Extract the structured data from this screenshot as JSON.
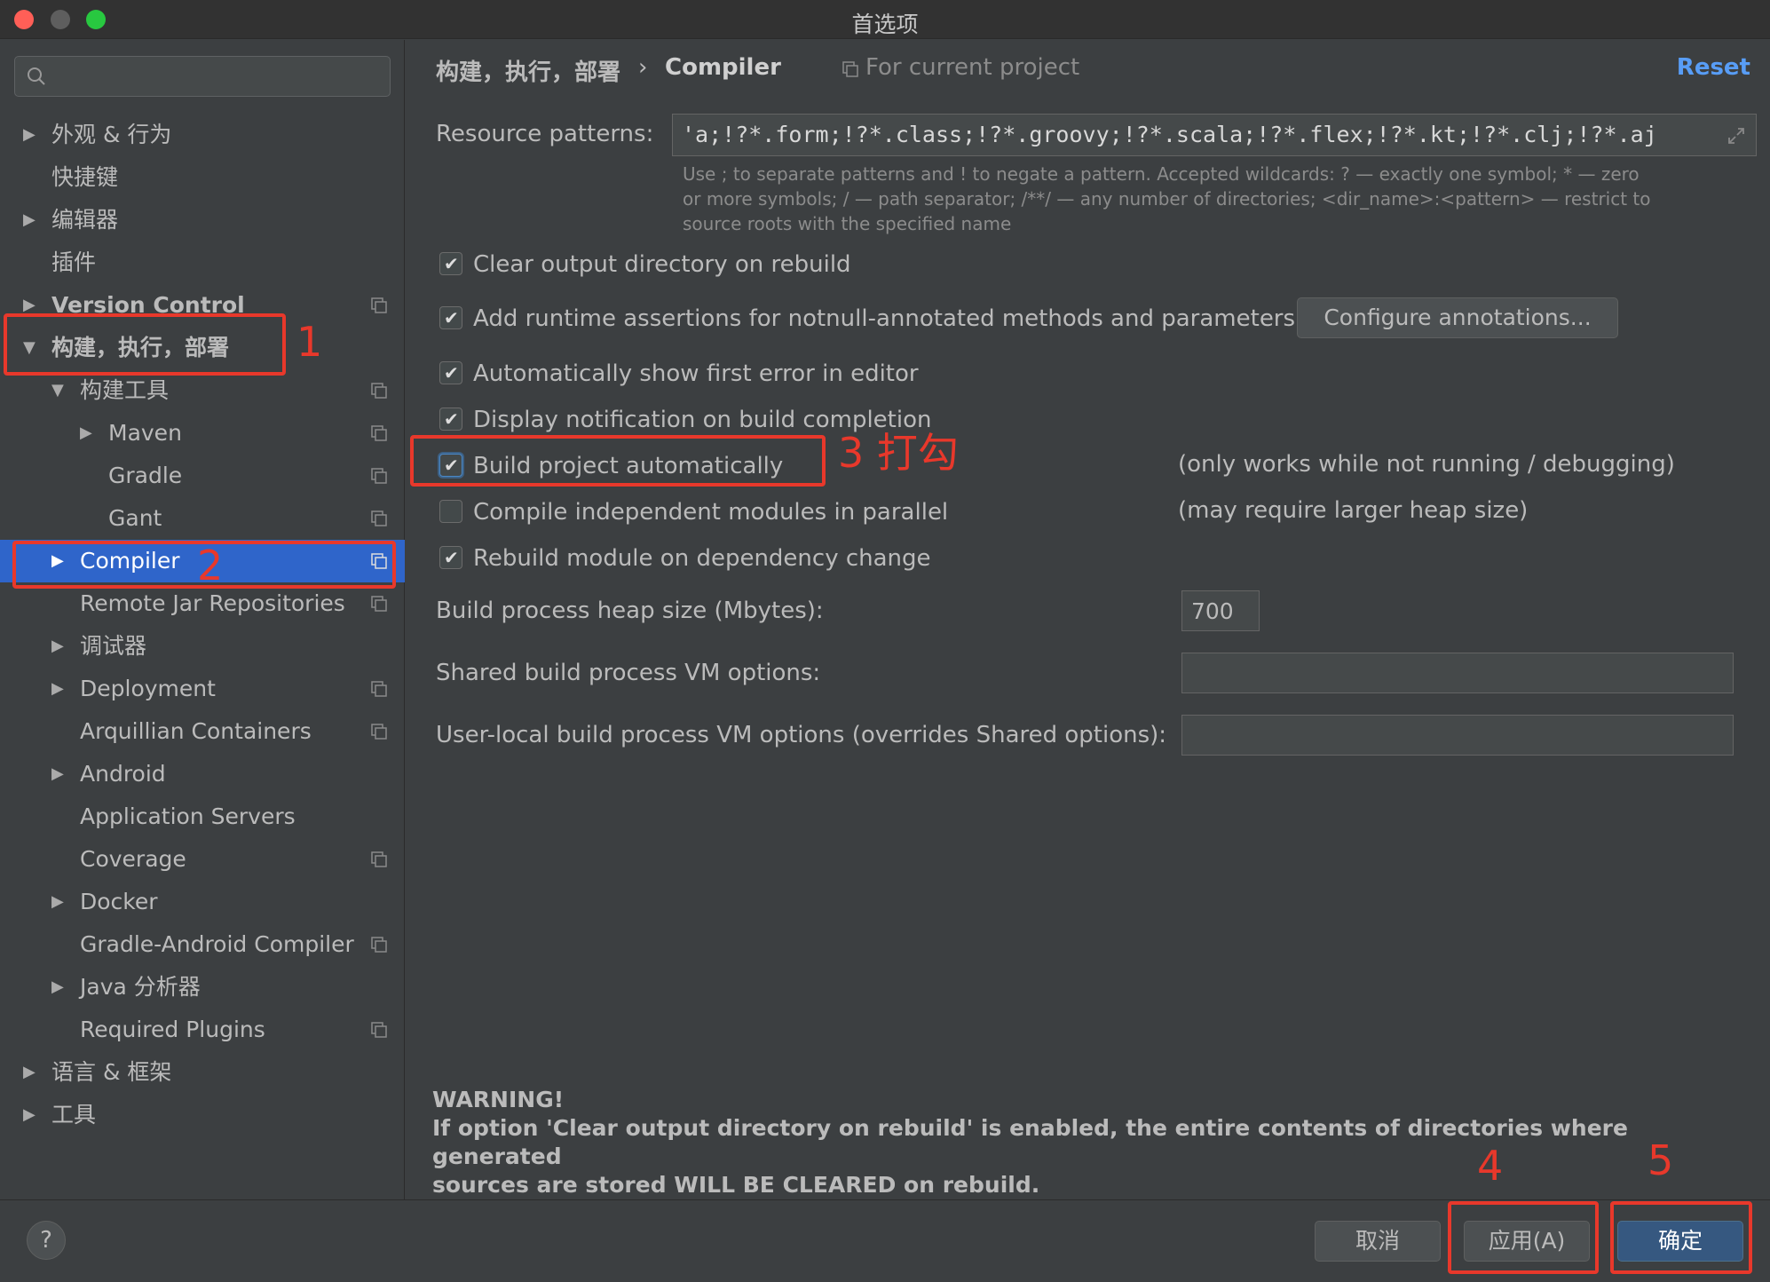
{
  "window": {
    "title": "首选项"
  },
  "search": {
    "placeholder": ""
  },
  "sidebar": {
    "items": [
      {
        "label": "外观 & 行为"
      },
      {
        "label": "快捷键"
      },
      {
        "label": "编辑器"
      },
      {
        "label": "插件"
      },
      {
        "label": "Version Control"
      },
      {
        "label": "构建，执行，部署"
      },
      {
        "label": "构建工具"
      },
      {
        "label": "Maven"
      },
      {
        "label": "Gradle"
      },
      {
        "label": "Gant"
      },
      {
        "label": "Compiler"
      },
      {
        "label": "Remote Jar Repositories"
      },
      {
        "label": "调试器"
      },
      {
        "label": "Deployment"
      },
      {
        "label": "Arquillian Containers"
      },
      {
        "label": "Android"
      },
      {
        "label": "Application Servers"
      },
      {
        "label": "Coverage"
      },
      {
        "label": "Docker"
      },
      {
        "label": "Gradle-Android Compiler"
      },
      {
        "label": "Java 分析器"
      },
      {
        "label": "Required Plugins"
      },
      {
        "label": "语言 & 框架"
      },
      {
        "label": "工具"
      }
    ],
    "selected": "Compiler"
  },
  "breadcrumb": {
    "parent": "构建，执行，部署",
    "separator": "›",
    "current": "Compiler",
    "scope_note": "For current project"
  },
  "header": {
    "reset_label": "Reset"
  },
  "settings": {
    "resource_patterns_label": "Resource patterns:",
    "resource_patterns_value": "'a;!?*.form;!?*.class;!?*.groovy;!?*.scala;!?*.flex;!?*.kt;!?*.clj;!?*.aj",
    "resource_hint_1": "Use ; to separate patterns and ! to negate a pattern. Accepted wildcards: ? — exactly one symbol; * — zero",
    "resource_hint_2": "or more symbols; / — path separator; /**/ — any number of directories; <dir_name>:<pattern> — restrict to",
    "resource_hint_3": "source roots with the specified name",
    "checkboxes": [
      {
        "label": "Clear output directory on rebuild",
        "checked": true
      },
      {
        "label": "Add runtime assertions for notnull-annotated methods and parameters",
        "checked": true
      },
      {
        "label": "Automatically show first error in editor",
        "checked": true
      },
      {
        "label": "Display notification on build completion",
        "checked": true
      },
      {
        "label": "Build project automatically",
        "checked": true
      },
      {
        "label": "Compile independent modules in parallel",
        "checked": false
      },
      {
        "label": "Rebuild module on dependency change",
        "checked": true
      }
    ],
    "configure_annotations_label": "Configure annotations...",
    "build_auto_note": "(only works while not running / debugging)",
    "parallel_note": "(may require larger heap size)",
    "heap_label": "Build process heap size (Mbytes):",
    "heap_value": "700",
    "shared_vm_label": "Shared build process VM options:",
    "shared_vm_value": "",
    "user_vm_label": "User-local build process VM options (overrides Shared options):",
    "user_vm_value": "",
    "warning_title": "WARNING!",
    "warning_line_1": "If option 'Clear output directory on rebuild' is enabled, the entire contents of directories where generated",
    "warning_line_2": "sources are stored WILL BE CLEARED on rebuild."
  },
  "footer": {
    "help_label": "?",
    "cancel_label": "取消",
    "apply_label": "应用(A)",
    "ok_label": "确定"
  },
  "annotations": {
    "step1": "1",
    "step2": "2",
    "step3": "3 打勾",
    "step4": "4",
    "step5": "5"
  },
  "colors": {
    "background": "#3c3f41",
    "selection": "#2f65ca",
    "link": "#589df6",
    "annotation": "#e8382b",
    "primary_button": "#365880"
  }
}
